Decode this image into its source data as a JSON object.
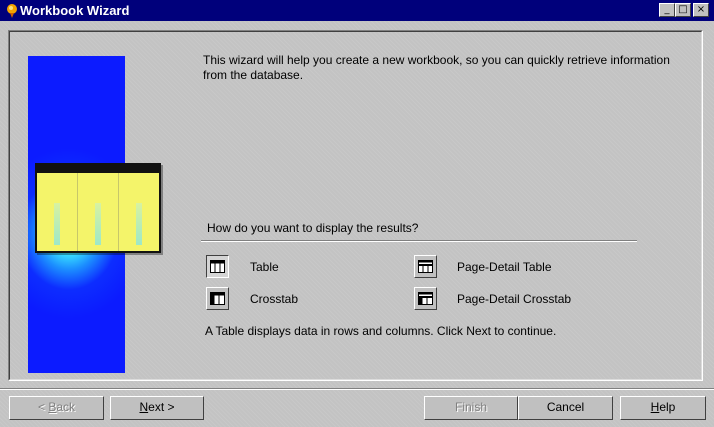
{
  "window": {
    "title": "Workbook Wizard",
    "controls": {
      "minimize": "_",
      "maximize": "□",
      "close": "×"
    }
  },
  "wizard": {
    "intro": "This wizard will help you create a new workbook, so you can quickly retrieve information from the database.",
    "question": "How do you want to display the results?",
    "options": [
      {
        "label": "Table",
        "icon": "table-icon",
        "selected": true
      },
      {
        "label": "Crosstab",
        "icon": "crosstab-icon",
        "selected": false
      },
      {
        "label": "Page-Detail Table",
        "icon": "page-detail-table-icon",
        "selected": false
      },
      {
        "label": "Page-Detail Crosstab",
        "icon": "page-detail-crosstab-icon",
        "selected": false
      }
    ],
    "description": "A Table displays data in rows and columns. Click Next to continue."
  },
  "buttons": {
    "back": {
      "pre": "< ",
      "mnemonic": "B",
      "post": "ack",
      "enabled": false
    },
    "next": {
      "pre": "",
      "mnemonic": "N",
      "post": "ext >",
      "enabled": true
    },
    "finish": {
      "label": "Finish",
      "enabled": false
    },
    "cancel": {
      "label": "Cancel",
      "enabled": true
    },
    "help": {
      "pre": "",
      "mnemonic": "H",
      "post": "elp",
      "enabled": true
    }
  },
  "colors": {
    "titlebar": "#00007b",
    "dialog": "#c3c3c3",
    "illustration_blue": "#0c1bff",
    "sheet_yellow": "#f4f46a"
  }
}
